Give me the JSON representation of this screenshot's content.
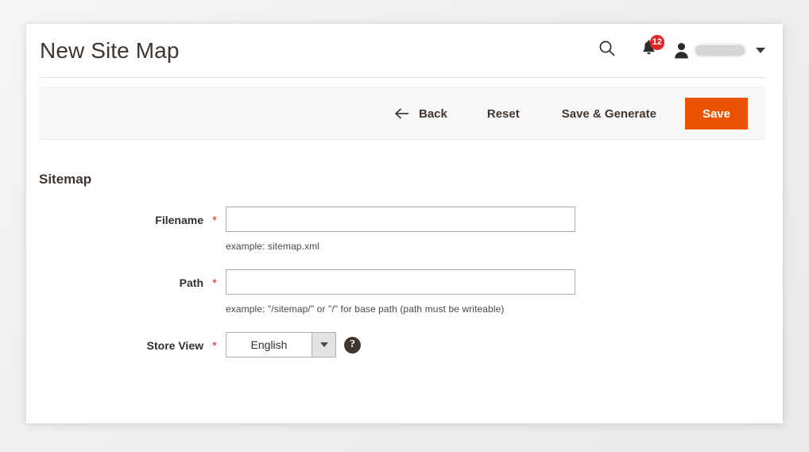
{
  "header": {
    "title": "New Site Map",
    "search_icon": "search-icon",
    "notifications": {
      "icon": "bell-icon",
      "count": "12"
    },
    "account": {
      "avatar_icon": "user-icon",
      "username": "",
      "caret_icon": "chevron-down-icon"
    }
  },
  "toolbar": {
    "back_label": "Back",
    "back_icon": "arrow-left-icon",
    "reset_label": "Reset",
    "save_generate_label": "Save & Generate",
    "save_label": "Save",
    "save_color": "#eb5202",
    "background": "#f8f8f8"
  },
  "form": {
    "section_title": "Sitemap",
    "required_marker": "*",
    "fields": [
      {
        "label": "Filename",
        "value": "",
        "note": "example: sitemap.xml"
      },
      {
        "label": "Path",
        "value": "",
        "note": "example: \"/sitemap/\" or \"/\" for base path (path must be writeable)"
      },
      {
        "label": "Store View",
        "value": "English",
        "help_icon": "question-mark-icon"
      }
    ]
  }
}
